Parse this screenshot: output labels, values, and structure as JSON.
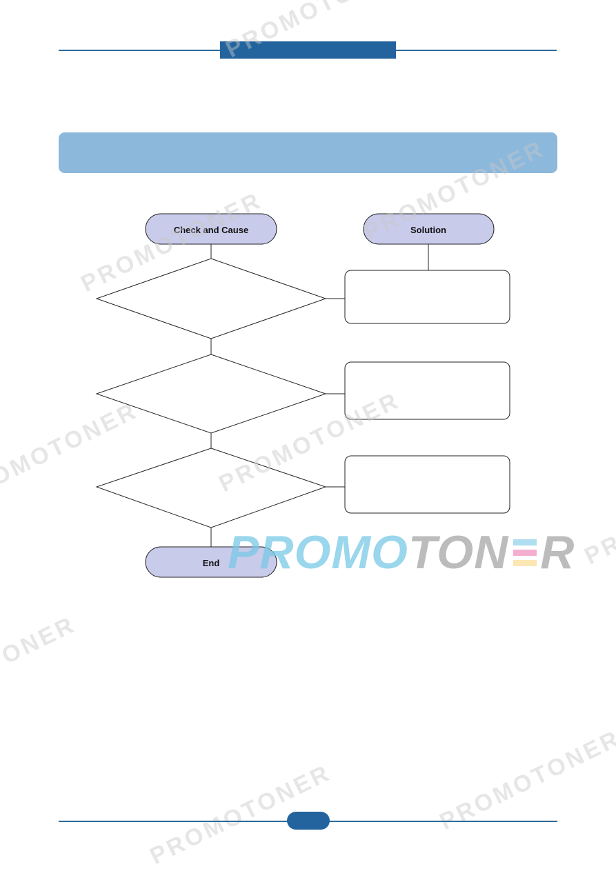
{
  "header": {
    "tab_text": ""
  },
  "section": {
    "title": ""
  },
  "flowchart": {
    "columns": {
      "check_label": "Check and Cause",
      "solution_label": "Solution"
    },
    "steps": [
      {
        "check": "",
        "solution": ""
      },
      {
        "check": "",
        "solution": ""
      },
      {
        "check": "",
        "solution": ""
      }
    ],
    "end_label": "End"
  },
  "footer": {
    "page_number": ""
  },
  "watermarks": {
    "text": "PROMOTONER",
    "brand_part1": "PROMO",
    "brand_part2": "TON",
    "brand_part3": "R"
  },
  "colors": {
    "header_blue": "#23649e",
    "section_bar": "#8cb8dc",
    "terminal_fill": "#c9cbeb",
    "line": "#2c6a9b"
  }
}
